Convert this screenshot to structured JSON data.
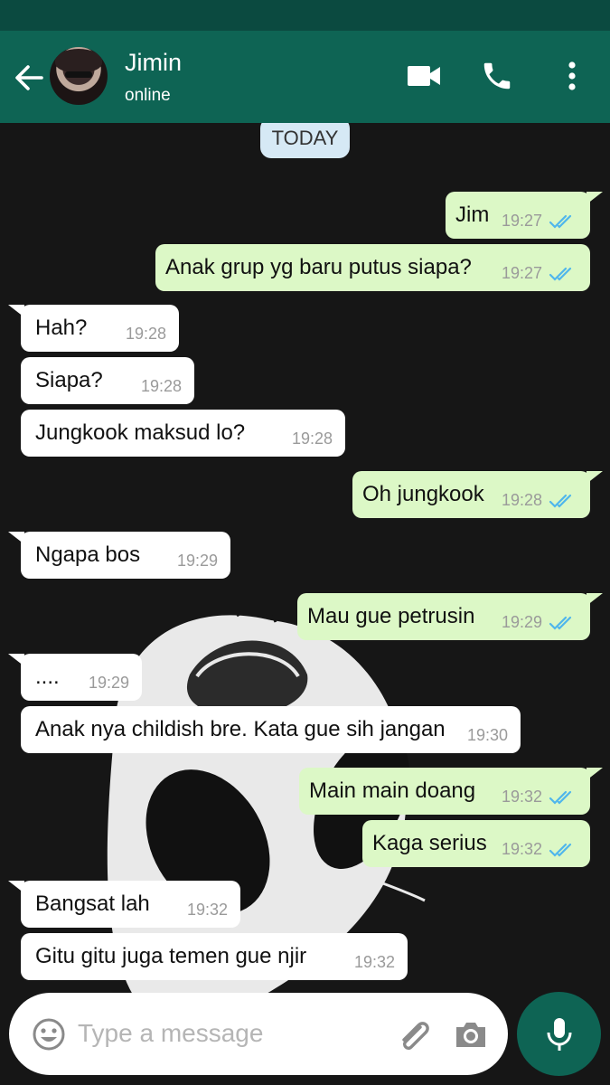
{
  "header": {
    "name": "Jimin",
    "status": "online"
  },
  "chat": {
    "date_chip": "TODAY",
    "messages": [
      {
        "dir": "out",
        "text": "Jim",
        "time": "19:27"
      },
      {
        "dir": "out",
        "text": "Anak grup yg baru putus siapa?",
        "time": "19:27"
      },
      {
        "dir": "in",
        "text": "Hah?",
        "time": "19:28"
      },
      {
        "dir": "in",
        "text": "Siapa?",
        "time": "19:28"
      },
      {
        "dir": "in",
        "text": "Jungkook maksud lo?",
        "time": "19:28"
      },
      {
        "dir": "out",
        "text": "Oh jungkook",
        "time": "19:28"
      },
      {
        "dir": "in",
        "text": "Ngapa bos",
        "time": "19:29"
      },
      {
        "dir": "out",
        "text": "Mau gue petrusin",
        "time": "19:29"
      },
      {
        "dir": "in",
        "text": "....",
        "time": "19:29"
      },
      {
        "dir": "in",
        "text": "Anak nya childish bre. Kata gue sih jangan",
        "time": "19:30"
      },
      {
        "dir": "out",
        "text": "Main main doang",
        "time": "19:32"
      },
      {
        "dir": "out",
        "text": "Kaga serius",
        "time": "19:32"
      },
      {
        "dir": "in",
        "text": "Bangsat lah",
        "time": "19:32"
      },
      {
        "dir": "in",
        "text": "Gitu gitu juga temen gue njir",
        "time": "19:32"
      }
    ]
  },
  "composer": {
    "placeholder": "Type a message"
  },
  "icons": {
    "back": "arrow-left-icon",
    "video": "video-call-icon",
    "call": "phone-icon",
    "menu": "more-vert-icon",
    "emoji": "emoji-icon",
    "attach": "paperclip-icon",
    "camera": "camera-icon",
    "mic": "microphone-icon",
    "read": "double-check-icon"
  },
  "colors": {
    "header": "#0e6454",
    "outgoing_bubble": "#dcf8c6",
    "incoming_bubble": "#ffffff",
    "read_ticks": "#4fb6ec"
  }
}
